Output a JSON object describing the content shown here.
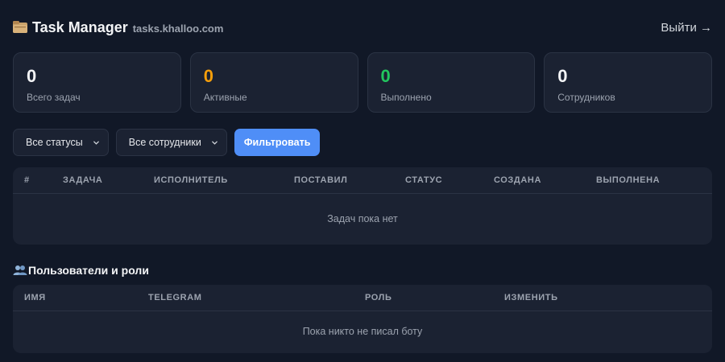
{
  "header": {
    "title": "Task Manager",
    "domain": "tasks.khalloo.com",
    "logout": "Выйти →",
    "icon": "folder-icon"
  },
  "stats": [
    {
      "value": "0",
      "label": "Всего задач",
      "color": "#f3f4f6"
    },
    {
      "value": "0",
      "label": "Активные",
      "color": "#f59e0b"
    },
    {
      "value": "0",
      "label": "Выполнено",
      "color": "#22c55e"
    },
    {
      "value": "0",
      "label": "Сотрудников",
      "color": "#f3f4f6"
    }
  ],
  "filters": {
    "status_selected": "Все статусы",
    "employee_selected": "Все сотрудники",
    "filter_button": "Фильтровать"
  },
  "tasks_table": {
    "columns": [
      "#",
      "ЗАДАЧА",
      "ИСПОЛНИТЕЛЬ",
      "ПОСТАВИЛ",
      "СТАТУС",
      "СОЗДАНА",
      "ВЫПОЛНЕНА"
    ],
    "empty_text": "Задач пока нет"
  },
  "users_section": {
    "title": "Пользователи и роли",
    "icon": "users-icon",
    "columns": [
      "ИМЯ",
      "TELEGRAM",
      "РОЛЬ",
      "ИЗМЕНИТЬ"
    ],
    "empty_text": "Пока никто не писал боту"
  },
  "colors": {
    "background": "#111827",
    "card": "#1b2232",
    "accent": "#4f8ef7",
    "active": "#f59e0b",
    "done": "#22c55e"
  }
}
